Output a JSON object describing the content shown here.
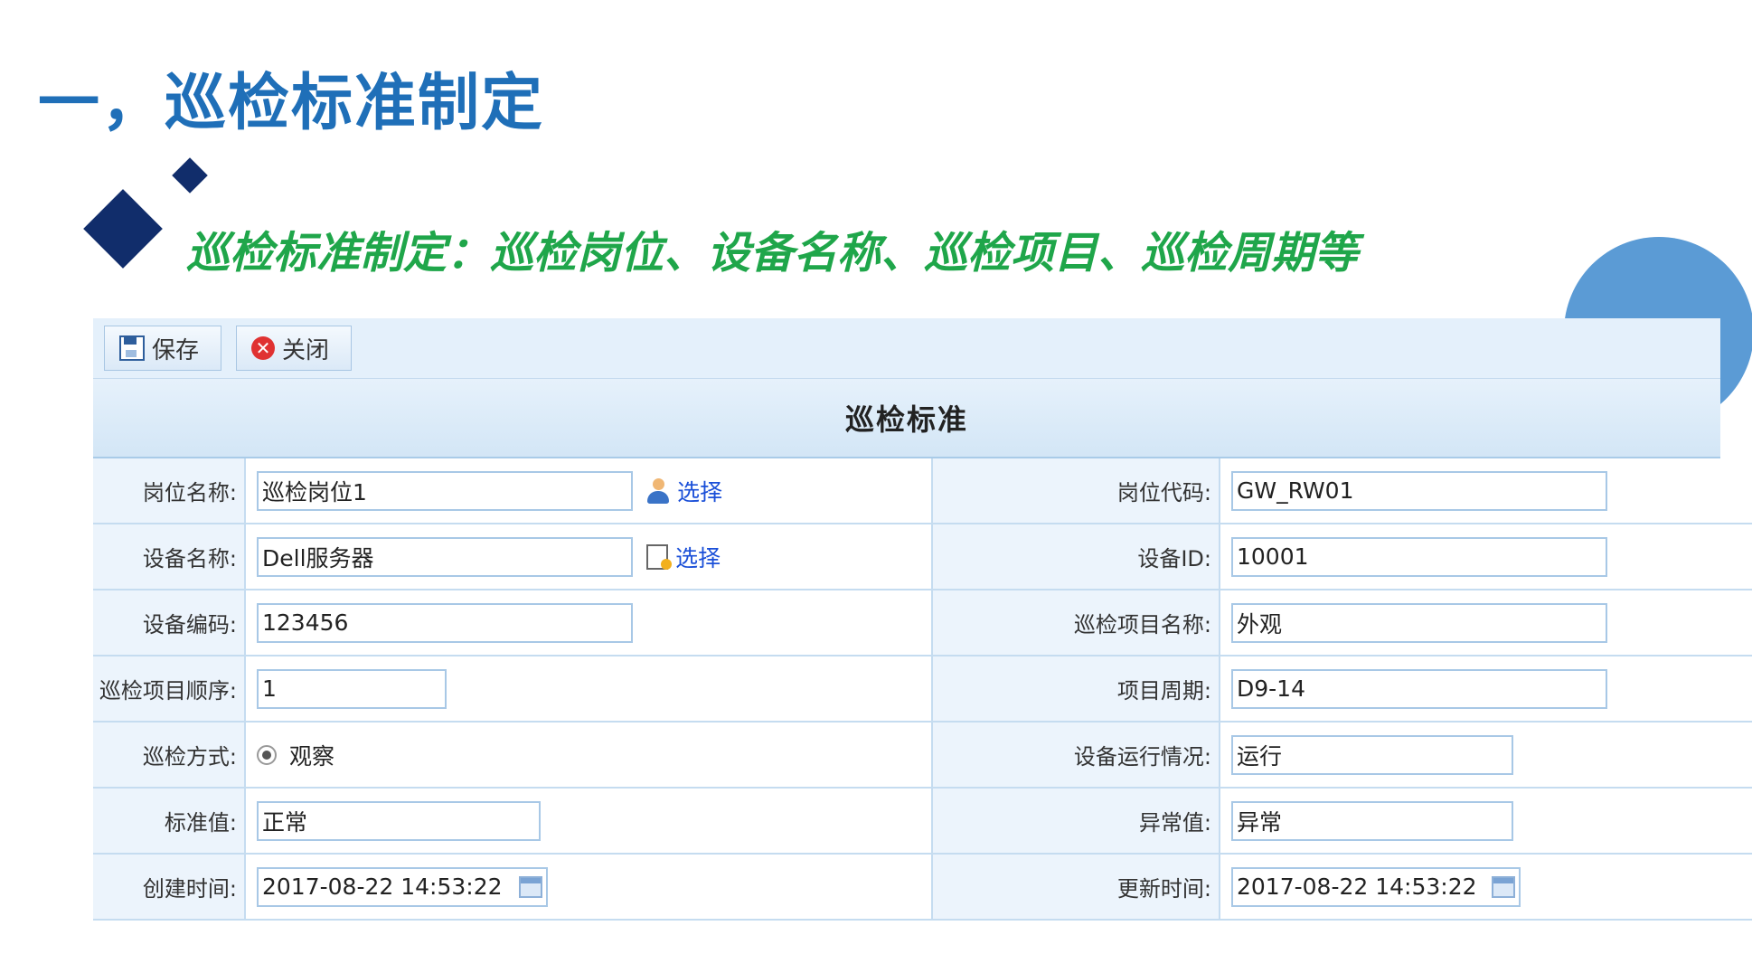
{
  "slide": {
    "title": "一，巡检标准制定",
    "subtitle": "巡检标准制定：巡检岗位、设备名称、巡检项目、巡检周期等"
  },
  "toolbar": {
    "save_label": "保存",
    "close_label": "关闭"
  },
  "form": {
    "title": "巡检标准",
    "pick_label": "选择",
    "rows": [
      {
        "left_label": "岗位名称:",
        "left_value": "巡检岗位1",
        "right_label": "岗位代码:",
        "right_value": "GW_RW01"
      },
      {
        "left_label": "设备名称:",
        "left_value": "Dell服务器",
        "right_label": "设备ID:",
        "right_value": "10001"
      },
      {
        "left_label": "设备编码:",
        "left_value": "123456",
        "right_label": "巡检项目名称:",
        "right_value": "外观"
      },
      {
        "left_label": "巡检项目顺序:",
        "left_value": "1",
        "right_label": "项目周期:",
        "right_value": "D9-14"
      },
      {
        "left_label": "巡检方式:",
        "left_value": "观察",
        "right_label": "设备运行情况:",
        "right_value": "运行"
      },
      {
        "left_label": "标准值:",
        "left_value": "正常",
        "right_label": "异常值:",
        "right_value": "异常"
      },
      {
        "left_label": "创建时间:",
        "left_value": "2017-08-22 14:53:22",
        "right_label": "更新时间:",
        "right_value": "2017-08-22 14:53:22"
      }
    ]
  },
  "colors": {
    "title_blue": "#1f6fb8",
    "subtitle_green": "#1fa64a",
    "diamond_navy": "#112d6b",
    "circle_blue": "#5b9bd5",
    "link_blue": "#1a4fd8"
  }
}
